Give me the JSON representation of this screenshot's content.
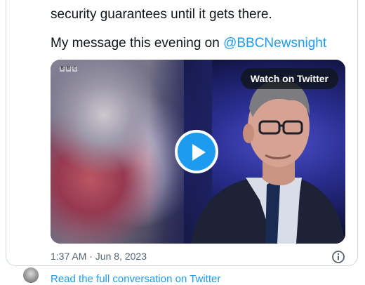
{
  "tweet": {
    "line1": "security guarantees until it gets there.",
    "line3_prefix": "My message this evening on ",
    "mention": "@BBCNewsnight",
    "timestamp": "1:37 AM · Jun 8, 2023"
  },
  "media": {
    "watch_label": "Watch on Twitter",
    "broadcaster_logo": "BBC"
  },
  "footer": {
    "link_text": "Read the full conversation on Twitter"
  },
  "colors": {
    "accent": "#1d9bf0",
    "text": "#0f1419",
    "muted": "#536471",
    "border": "#cfd9de"
  },
  "icons": [
    "play-icon",
    "info-icon"
  ]
}
